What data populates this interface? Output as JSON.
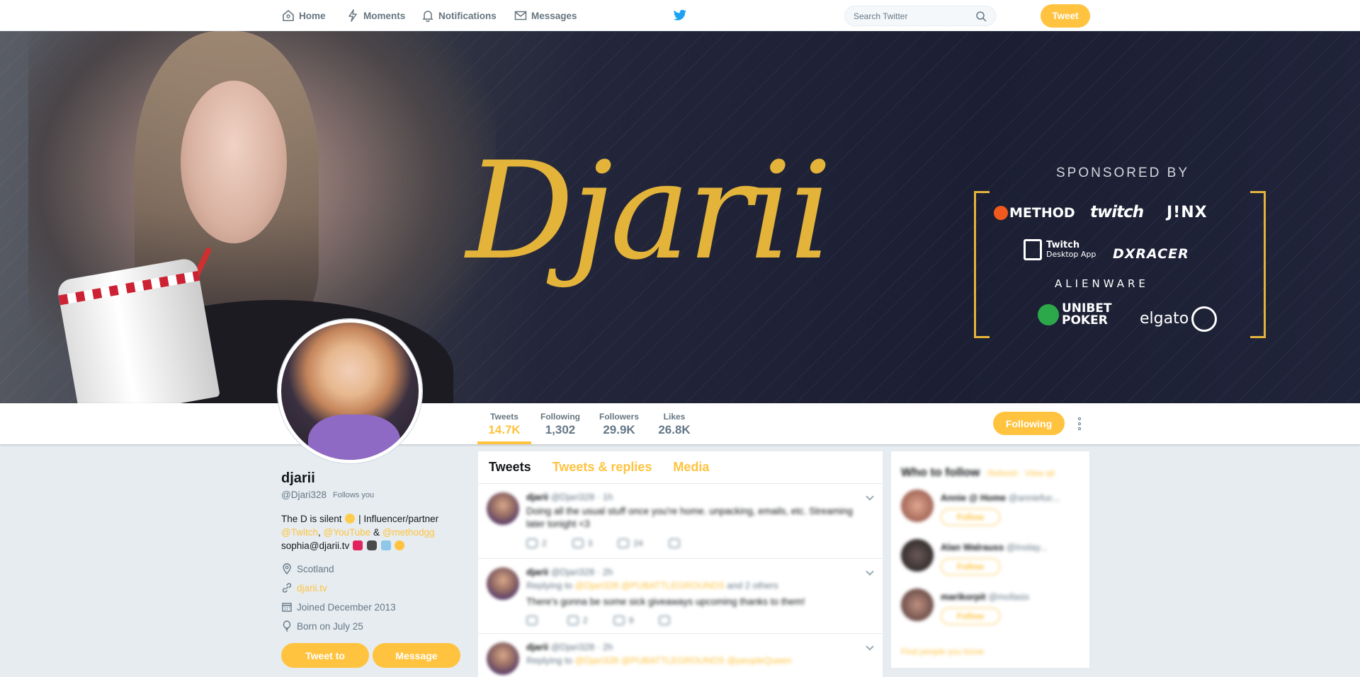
{
  "nav": {
    "home": "Home",
    "moments": "Moments",
    "notifications": "Notifications",
    "messages": "Messages",
    "search_placeholder": "Search Twitter",
    "tweet_button": "Tweet"
  },
  "banner": {
    "logo_text": "Djarii",
    "sponsored_by": "SPONSORED BY",
    "sponsors": {
      "method": "METHOD",
      "twitch": "twitch",
      "jinx": "J!NX",
      "twitch_app": "Twitch",
      "twitch_app_sub": "Desktop App",
      "dxracer": "DXRACER",
      "alienware": "ALIENWARE",
      "unibet_1": "UNIBET",
      "unibet_2": "POKER",
      "elgato": "elgato"
    }
  },
  "profile_nav": {
    "stats": [
      {
        "label": "Tweets",
        "value": "14.7K"
      },
      {
        "label": "Following",
        "value": "1,302"
      },
      {
        "label": "Followers",
        "value": "29.9K"
      },
      {
        "label": "Likes",
        "value": "26.8K"
      }
    ],
    "following_button": "Following"
  },
  "profile": {
    "name": "djarii",
    "handle": "@Djari328",
    "follows_you": "Follows you",
    "bio_1": "The D is silent",
    "bio_2": "| Influencer/partner",
    "bio_link_twitch": "@Twitch",
    "bio_sep": ",",
    "bio_link_youtube": "@YouTube",
    "bio_amp": "&",
    "bio_link_method": "@methodgg",
    "bio_email": "sophia@djarii.tv",
    "location": "Scotland",
    "url": "djarii.tv",
    "joined": "Joined December 2013",
    "born": "Born on July 25",
    "tweet_to_button": "Tweet to",
    "message_button": "Message"
  },
  "timeline": {
    "tabs": [
      "Tweets",
      "Tweets & replies",
      "Media"
    ],
    "tweets": [
      {
        "name": "djarii",
        "meta": "@Djari328 · 1h",
        "text": "Doing all the usual stuff once you're home. unpacking, emails, etc. Streaming later tonight <3",
        "replies": "2",
        "retweets": "3",
        "likes": "24"
      },
      {
        "name": "djarii",
        "meta": "@Djari328 · 2h",
        "reply_prefix": "Replying to",
        "reply_to": "@Djari328 @PUBATTLEGROUNDS",
        "reply_suffix": "and 2 others",
        "text": "There's gonna be some sick giveaways upcoming thanks to them!",
        "replies": "",
        "retweets": "2",
        "likes": "9"
      },
      {
        "name": "djarii",
        "meta": "@Djari328 · 2h",
        "reply_prefix": "Replying to",
        "reply_to": "@Djari328 @PUBATTLEGROUNDS @peopleQueen"
      }
    ]
  },
  "who_to_follow": {
    "title": "Who to follow",
    "refresh": "· Refresh · View all",
    "users": [
      {
        "name": "Annie @ Home",
        "handle": "@anniefuc...",
        "follow": "Follow"
      },
      {
        "name": "Alan Walrauss",
        "handle": "@Inolay...",
        "follow": "Follow"
      },
      {
        "name": "marikorpit",
        "handle": "@mofasix",
        "follow": "Follow"
      }
    ],
    "find_people": "Find people you know"
  },
  "colors": {
    "accent": "#ffc33f",
    "banner_gold": "#e3b33a",
    "page_bg": "#e6ecf0"
  }
}
